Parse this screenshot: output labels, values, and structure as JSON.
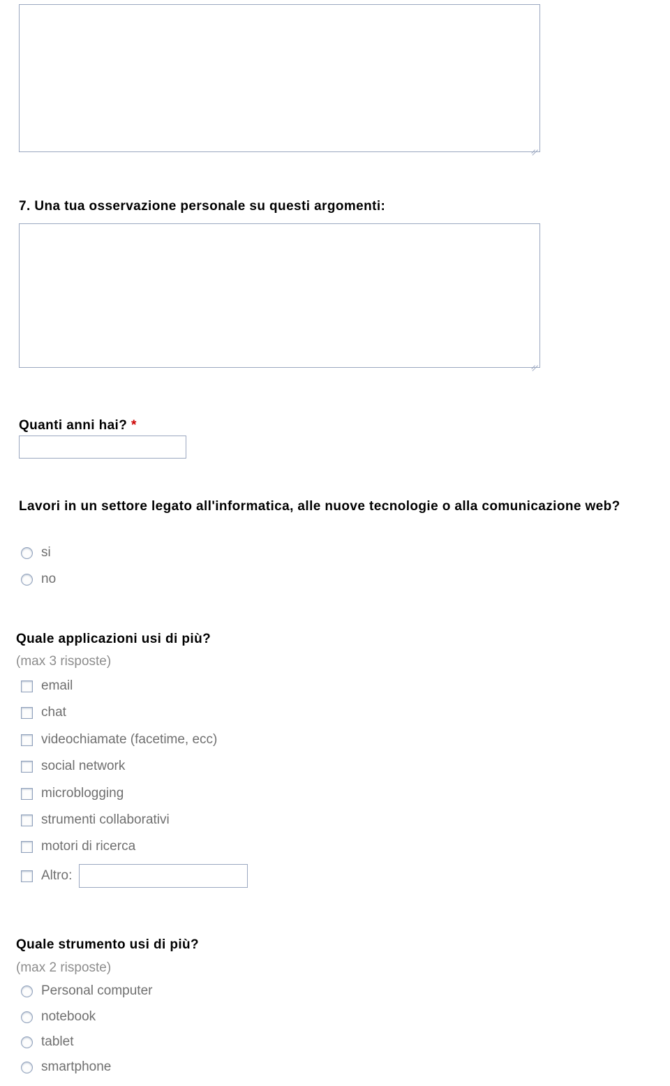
{
  "document": {
    "language": "it",
    "top_textarea": {
      "name": "risposta-domanda-6",
      "value": "",
      "placeholder": ""
    },
    "questions": [
      {
        "id": "q7",
        "number": "7.",
        "label": "Una tua osservazione personale su questi argomenti:",
        "required": false,
        "type": "textarea",
        "value": ""
      },
      {
        "id": "q_eta",
        "label": "Quanti anni hai?",
        "required": true,
        "required_marker": "*",
        "type": "text",
        "value": ""
      },
      {
        "id": "q_settore",
        "label": "Lavori in un settore legato all'informatica, alle nuove tecnologie o alla comunicazione web?",
        "required": false,
        "type": "radio",
        "options": [
          {
            "label": "si",
            "checked": false
          },
          {
            "label": "no",
            "checked": false
          }
        ]
      },
      {
        "id": "q_applicazioni",
        "label": "Quale applicazioni usi di più?",
        "sublabel": "(max 3 risposte)",
        "type": "checkbox",
        "options": [
          {
            "label": "email",
            "checked": false
          },
          {
            "label": "chat",
            "checked": false
          },
          {
            "label": "videochiamate (facetime, ecc)",
            "checked": false
          },
          {
            "label": "social network",
            "checked": false
          },
          {
            "label": "microblogging",
            "checked": false
          },
          {
            "label": "strumenti collaborativi",
            "checked": false
          },
          {
            "label": "motori di ricerca",
            "checked": false
          },
          {
            "label": "Altro:",
            "checked": false,
            "has_input": true,
            "input_value": ""
          }
        ]
      },
      {
        "id": "q_strumento",
        "label": "Quale strumento usi di più?",
        "sublabel": "(max 2 risposte)",
        "type": "radio",
        "options": [
          {
            "label": "Personal computer",
            "checked": false
          },
          {
            "label": "notebook",
            "checked": false
          },
          {
            "label": "tablet",
            "checked": false
          },
          {
            "label": "smartphone",
            "checked": false
          }
        ]
      }
    ],
    "colors": {
      "field_border": "#9aa7c0",
      "label_text": "#000000",
      "option_text": "#6f6f6f",
      "muted_text": "#8d8d8d",
      "required_marker": "#cc0000"
    }
  }
}
